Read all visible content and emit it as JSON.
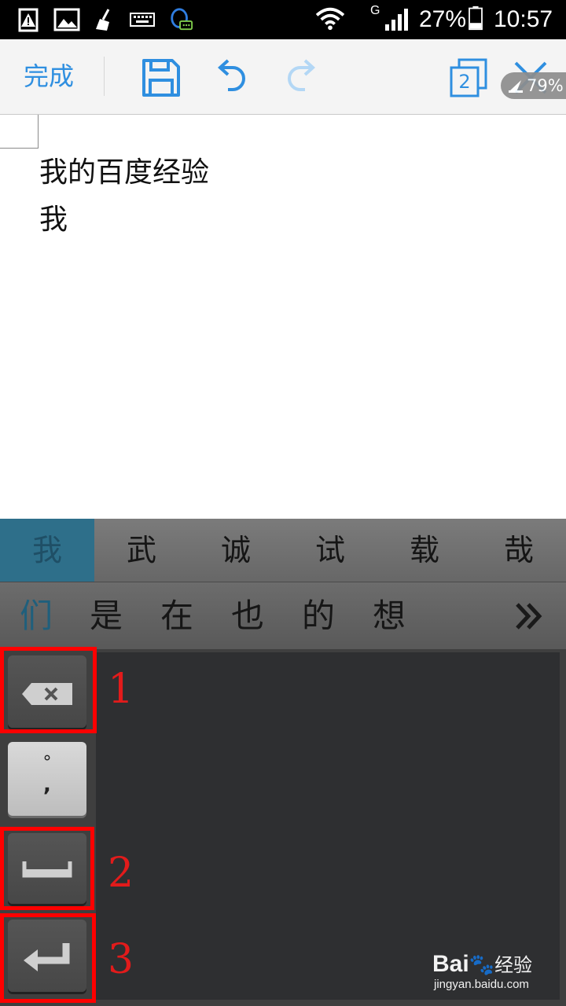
{
  "status_bar": {
    "signal_type": "G",
    "battery_percent": "27%",
    "time": "10:57",
    "icons": [
      "battery-warning-icon",
      "image-icon",
      "cleaner-icon",
      "keyboard-icon",
      "qq-icon",
      "wifi-icon",
      "cellular-signal-icon",
      "battery-icon"
    ]
  },
  "toolbar": {
    "done_label": "完成",
    "page_count": "2",
    "icons": [
      "save-icon",
      "undo-icon",
      "redo-icon",
      "pages-icon",
      "close-icon"
    ]
  },
  "floating_badge": {
    "percent": "79%"
  },
  "document": {
    "lines": [
      "我的百度经验",
      "我"
    ]
  },
  "candidates_row1": [
    "我",
    "武",
    "诚",
    "试",
    "载",
    "哉"
  ],
  "candidates_row2": [
    "们",
    "是",
    "在",
    "也",
    "的",
    "想"
  ],
  "keyboard": {
    "punct_top": "°",
    "punct_bottom": ","
  },
  "annotations": {
    "labels": [
      "1",
      "2",
      "3"
    ]
  },
  "watermark": {
    "brand": "Bai",
    "brand_suffix": "经验",
    "url": "jingyan.baidu.com"
  },
  "colors": {
    "accent": "#2f8fe0",
    "selection": "#2e6f8a",
    "annotation_red": "#ff0000"
  }
}
